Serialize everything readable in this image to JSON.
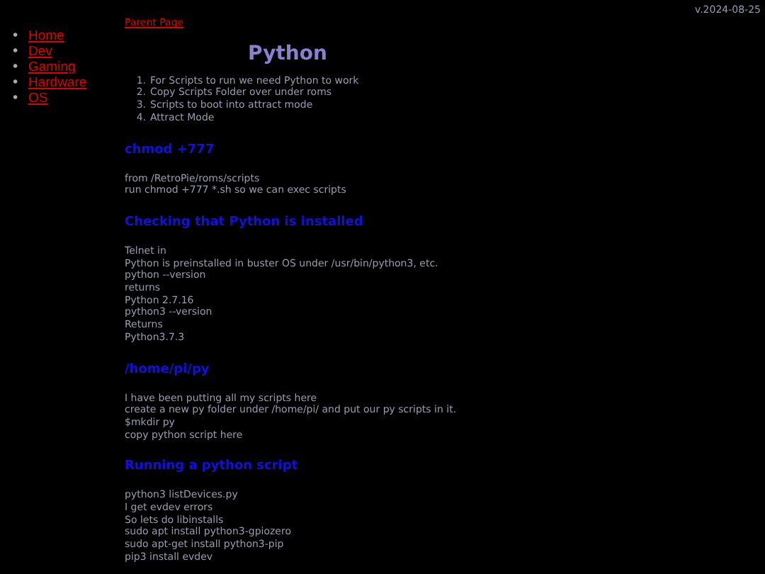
{
  "version": "v.2024-08-25",
  "sidebar": {
    "items": [
      {
        "marker": "•",
        "label": "Home"
      },
      {
        "marker": "•",
        "label": "Dev"
      },
      {
        "marker": "•",
        "label": "Gaming"
      },
      {
        "marker": "•",
        "label": "Hardware"
      },
      {
        "marker": "•",
        "label": "OS"
      }
    ]
  },
  "parent_link": "Parent Page",
  "title": "Python",
  "steps": [
    {
      "number": "1.",
      "text": "For Scripts to run we need Python to work"
    },
    {
      "number": "2.",
      "text": "Copy Scripts Folder over under roms"
    },
    {
      "number": "3.",
      "text": "Scripts to boot into attract mode"
    },
    {
      "number": "4.",
      "text": "Attract Mode"
    }
  ],
  "sections": [
    {
      "heading": "chmod +777",
      "lines": [
        "from /RetroPie/roms/scripts",
        "run chmod +777 *.sh so we can exec scripts"
      ]
    },
    {
      "heading": "Checking that Python is installed",
      "lines": [
        "Telnet in",
        "Python is preinstalled in buster OS under /usr/bin/python3, etc.",
        "python --version",
        "returns",
        "Python 2.7.16",
        "python3 --version",
        "Returns",
        "Python3.7.3"
      ]
    },
    {
      "heading": "/home/pi/py",
      "lines": [
        "I have been putting all my scripts here",
        "create a new py folder under /home/pi/ and put our py scripts in it.",
        "$mkdir py",
        "copy python script here"
      ]
    },
    {
      "heading": "Running a python script",
      "lines": [
        "python3 listDevices.py",
        "I get evdev errors",
        "So lets do libinstalls",
        "sudo apt install python3-gpiozero",
        "sudo apt-get install python3-pip",
        "pip3 install evdev"
      ]
    }
  ]
}
